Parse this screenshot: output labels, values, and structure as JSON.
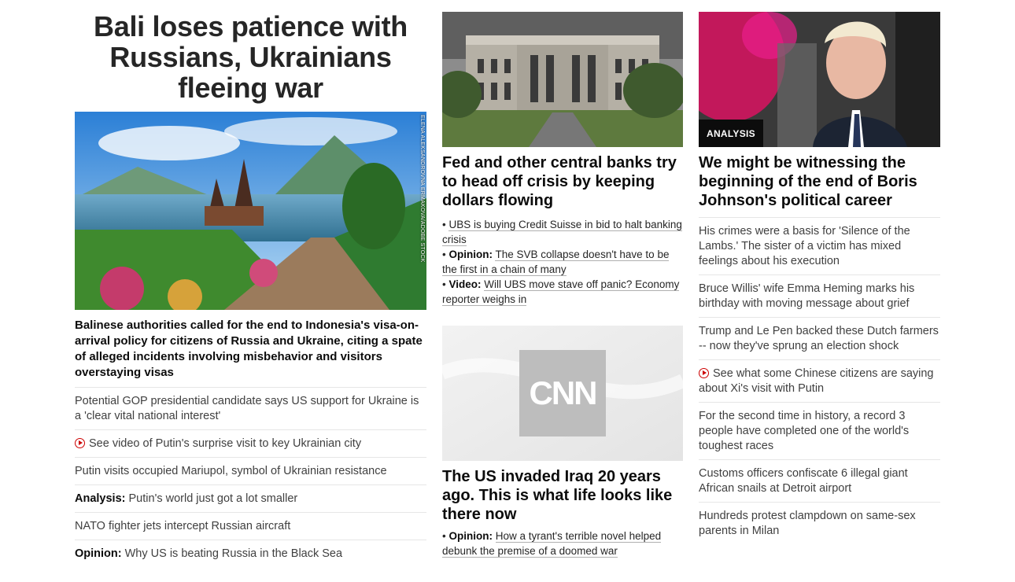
{
  "lead": {
    "title": "Bali loses patience with Russians, Ukrainians fleeing war",
    "image_credit": "ELENA ALEKSANDROVNA ERMAKOVA/ADOBE STOCK",
    "description": "Balinese authorities called for the end to Indonesia's visa-on-arrival policy for citizens of Russia and Ukraine, citing a spate of alleged incidents involving misbehavior and visitors overstaying visas",
    "links": [
      {
        "label": "",
        "text": "Potential GOP presidential candidate says US support for Ukraine is a 'clear vital national interest'",
        "video": false
      },
      {
        "label": "",
        "text": "See video of Putin's surprise visit to key Ukrainian city",
        "video": true
      },
      {
        "label": "",
        "text": "Putin visits occupied Mariupol, symbol of Ukrainian resistance",
        "video": false
      },
      {
        "label": "Analysis:",
        "text": "Putin's world just got a lot smaller",
        "video": false
      },
      {
        "label": "",
        "text": "NATO fighter jets intercept Russian aircraft",
        "video": false
      },
      {
        "label": "Opinion:",
        "text": "Why US is beating Russia in the Black Sea",
        "video": false
      }
    ]
  },
  "fed": {
    "title": "Fed and other central banks try to head off crisis by keeping dollars flowing",
    "bullets": [
      {
        "label": "",
        "text": "UBS is buying Credit Suisse in bid to halt banking crisis"
      },
      {
        "label": "Opinion:",
        "text": "The SVB collapse doesn't have to be the first in a chain of many"
      },
      {
        "label": "Video:",
        "text": "Will UBS move stave off panic? Economy reporter weighs in"
      }
    ]
  },
  "iraq": {
    "logo_text": "CNN",
    "title": "The US invaded Iraq 20 years ago. This is what life looks like there now",
    "bullets": [
      {
        "label": "Opinion:",
        "text": "How a tyrant's terrible novel helped debunk the premise of a doomed war"
      }
    ]
  },
  "boris": {
    "badge": "ANALYSIS",
    "title": "We might be witnessing the beginning of the end of Boris Johnson's political career",
    "links": [
      {
        "label": "",
        "text": "His crimes were a basis for 'Silence of the Lambs.' The sister of a victim has mixed feelings about his execution",
        "video": false
      },
      {
        "label": "",
        "text": "Bruce Willis' wife Emma Heming marks his birthday with moving message about grief",
        "video": false
      },
      {
        "label": "",
        "text": "Trump and Le Pen backed these Dutch farmers -- now they've sprung an election shock",
        "video": false
      },
      {
        "label": "",
        "text": "See what some Chinese citizens are saying about Xi's visit with Putin",
        "video": true
      },
      {
        "label": "",
        "text": "For the second time in history, a record 3 people have completed one of the world's toughest races",
        "video": false
      },
      {
        "label": "",
        "text": "Customs officers confiscate 6 illegal giant African snails at Detroit airport",
        "video": false
      },
      {
        "label": "",
        "text": "Hundreds protest clampdown on same-sex parents in Milan",
        "video": false
      }
    ]
  },
  "colors": {
    "accent_red": "#cc0000",
    "text": "#0c0c0c",
    "divider": "#e6e6e6"
  }
}
